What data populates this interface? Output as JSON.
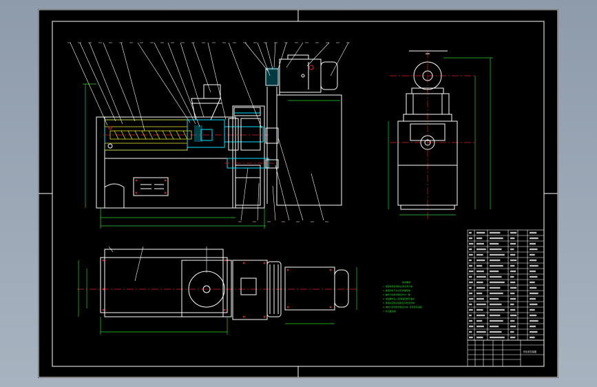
{
  "colors": {
    "background": "#9aa6b4",
    "paper": "#000000",
    "outline": "#ffffff",
    "centerline": "#e02020",
    "dimension": "#29d629",
    "section": "#00e5ff",
    "hatch": "#e0e020",
    "leader": "#ffffff"
  },
  "drawing": {
    "views": [
      {
        "id": "front-section-view"
      },
      {
        "id": "side-view"
      },
      {
        "id": "top-view"
      }
    ],
    "technical_requirements": {
      "title": "技术要求",
      "lines": [
        "1. 装配前所有零件必须清洗干净.",
        "2. 各密封处不允许有渗漏现象.",
        "3. 螺杆与机筒间隙应均匀一致.",
        "4. 减速器内注入润滑油至规定油位.",
        "5. 装配后空载试运转应平稳无异响.",
        "6. 电机与皮带轮安装应对中, 皮带张紧适度.",
        "7. 外表面涂漆."
      ]
    },
    "parts_list": {
      "rows": 20,
      "columns": 5
    },
    "title_block": {
      "name": "挤出机总装图"
    }
  }
}
